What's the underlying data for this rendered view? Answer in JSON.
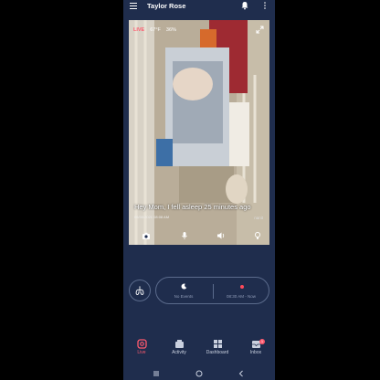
{
  "header": {
    "title": "Taylor Rose",
    "menu_icon": "menu-icon",
    "bell_icon": "bell-icon",
    "more_icon": "more-vertical-icon"
  },
  "camera": {
    "live_label": "LIVE",
    "temperature": "67°F",
    "humidity": "36%",
    "caption": "Hey Mom, I fell asleep 25 minutes ago",
    "timestamp": "06/30/2021 08:08 AM",
    "brand": "nanit",
    "controls": [
      "camera-icon",
      "microphone-icon",
      "speaker-icon",
      "nightlight-icon"
    ]
  },
  "status": {
    "events_label": "No Events",
    "time_range": "08:30 AM - Now"
  },
  "nav": {
    "items": [
      {
        "label": "Live",
        "icon": "live-icon"
      },
      {
        "label": "Activity",
        "icon": "activity-icon"
      },
      {
        "label": "Dashboard",
        "icon": "dashboard-icon"
      },
      {
        "label": "Inbox",
        "icon": "inbox-icon",
        "badge": "1"
      }
    ]
  },
  "colors": {
    "background": "#1f2d4d",
    "accent": "#ff5a6e"
  }
}
